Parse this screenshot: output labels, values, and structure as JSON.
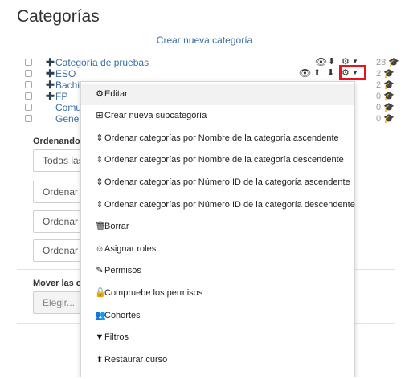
{
  "page": {
    "title": "Categorías",
    "create_link": "Crear nueva categoría"
  },
  "categories": [
    {
      "name": "Categoría de pruebas",
      "count": "28",
      "has_plus": true
    },
    {
      "name": "ESO",
      "count": "2",
      "has_plus": true
    },
    {
      "name": "Bachil",
      "count": "2",
      "has_plus": true
    },
    {
      "name": "FP",
      "count": "0",
      "has_plus": true
    },
    {
      "name": "Comu",
      "count": "0",
      "has_plus": false
    },
    {
      "name": "Gener",
      "count": "0",
      "has_plus": false
    }
  ],
  "sort_section": {
    "heading": "Ordenando",
    "controls": [
      "Todas las",
      "Ordenar p",
      "Ordenar p",
      "Ordenar"
    ]
  },
  "move_section": {
    "heading": "Mover las c",
    "select_placeholder": "Elegir..."
  },
  "icons": {
    "plus": "plus-icon",
    "eye": "eye-icon",
    "up": "arrow-up-icon",
    "down": "arrow-down-icon",
    "gear": "gear-icon",
    "caret": "caret-down-icon",
    "count": "graduation-cap-icon"
  },
  "colors": {
    "link": "#3a6ea5",
    "highlight_border": "#e8141b",
    "muted": "#9a9a9a"
  },
  "context_menu": {
    "items": [
      {
        "label": "Editar",
        "icon": "gear-icon"
      },
      {
        "label": "Crear nueva subcategoría",
        "icon": "plus-square-icon"
      },
      {
        "label": "Ordenar categorías por Nombre de la categoría ascendente",
        "icon": "sort-icon"
      },
      {
        "label": "Ordenar categorías por Nombre de la categoría descendente",
        "icon": "sort-icon"
      },
      {
        "label": "Ordenar categorías por Número ID de la categoría ascendente",
        "icon": "sort-icon"
      },
      {
        "label": "Ordenar categorías por Número ID de la categoría descendente",
        "icon": "sort-icon"
      },
      {
        "label": "Borrar",
        "icon": "trash-icon"
      },
      {
        "label": "Asignar roles",
        "icon": "user-circle-icon"
      },
      {
        "label": "Permisos",
        "icon": "edit-icon"
      },
      {
        "label": "Compruebe los permisos",
        "icon": "unlock-icon"
      },
      {
        "label": "Cohortes",
        "icon": "users-icon"
      },
      {
        "label": "Filtros",
        "icon": "filter-icon"
      },
      {
        "label": "Restaurar curso",
        "icon": "upload-icon"
      }
    ]
  }
}
